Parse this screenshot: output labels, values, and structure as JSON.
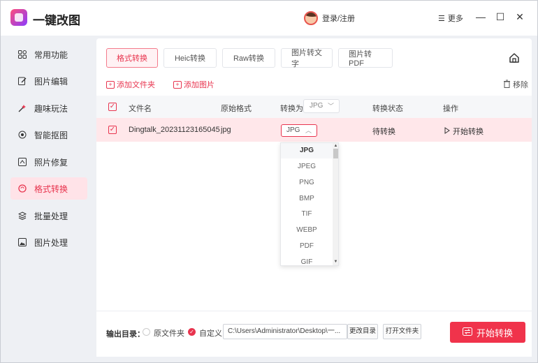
{
  "app": {
    "title": "一键改图",
    "login_label": "登录/注册",
    "more_label": "更多"
  },
  "window_controls": {
    "minimize": "—",
    "maximize": "☐",
    "close": "✕"
  },
  "sidebar": {
    "items": [
      {
        "label": "常用功能",
        "icon": "grid-icon"
      },
      {
        "label": "图片编辑",
        "icon": "edit-icon"
      },
      {
        "label": "趣味玩法",
        "icon": "magic-icon"
      },
      {
        "label": "智能抠图",
        "icon": "target-icon"
      },
      {
        "label": "照片修复",
        "icon": "repair-icon"
      },
      {
        "label": "格式转换",
        "icon": "convert-icon",
        "active": true
      },
      {
        "label": "批量处理",
        "icon": "layers-icon"
      },
      {
        "label": "图片处理",
        "icon": "image-icon"
      }
    ]
  },
  "tabs": [
    {
      "label": "格式转换",
      "active": true
    },
    {
      "label": "Heic转换"
    },
    {
      "label": "Raw转换"
    },
    {
      "label": "图片转文字"
    },
    {
      "label": "图片转PDF"
    }
  ],
  "toolbar": {
    "add_folder": "添加文件夹",
    "add_image": "添加图片",
    "remove": "移除"
  },
  "table": {
    "headers": {
      "filename": "文件名",
      "orig_format": "原始格式",
      "convert_to": "转换为",
      "convert_to_value": "JPG",
      "status": "转换状态",
      "action": "操作"
    },
    "rows": [
      {
        "filename": "Dingtalk_20231123165045",
        "orig_format": "jpg",
        "target": "JPG",
        "status": "待转换",
        "action": "开始转换"
      }
    ]
  },
  "dropdown": {
    "options": [
      "JPG",
      "JPEG",
      "PNG",
      "BMP",
      "TIF",
      "WEBP",
      "PDF",
      "GIF"
    ],
    "selected": "JPG"
  },
  "footer": {
    "output_label": "输出目录：",
    "opt_original": "原文件夹",
    "opt_custom": "自定义",
    "path": "C:\\Users\\Administrator\\Desktop\\一...",
    "change_dir": "更改目录",
    "open_folder": "打开文件夹",
    "start": "开始转换"
  },
  "colors": {
    "accent": "#f0334b",
    "active_bg": "#ffe3e8",
    "row_bg": "#ffe7ea"
  }
}
